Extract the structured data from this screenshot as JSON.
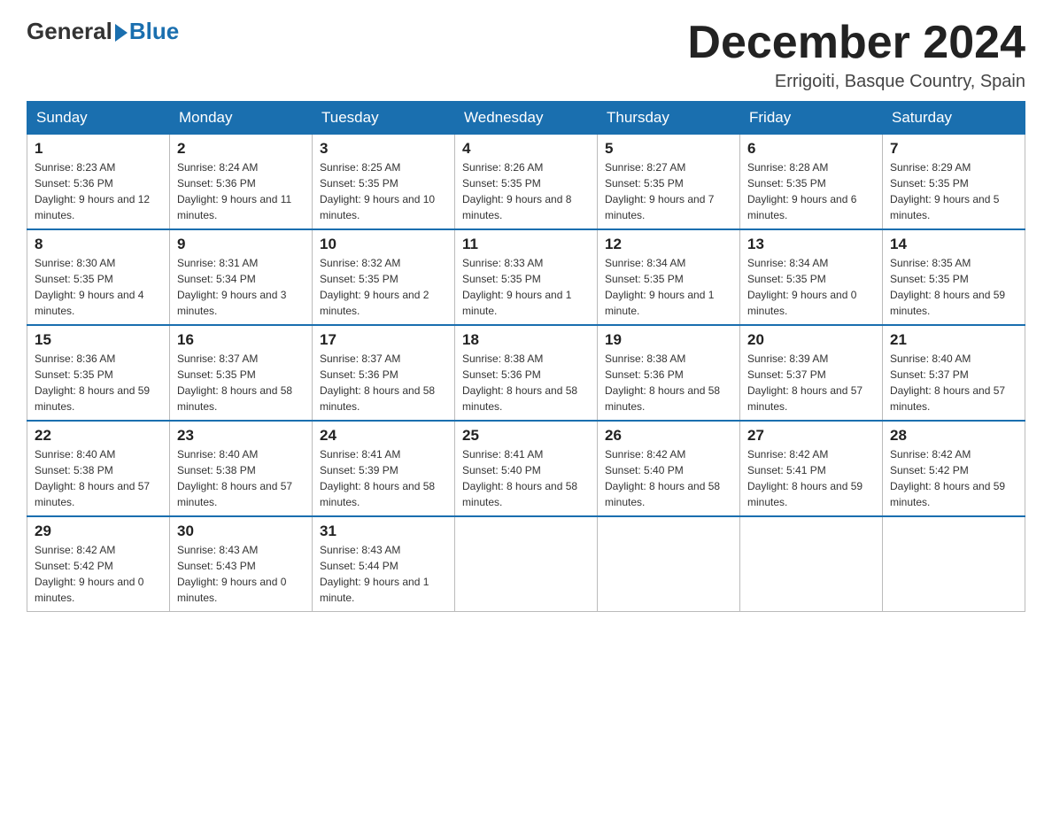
{
  "logo": {
    "text_general": "General",
    "text_blue": "Blue"
  },
  "header": {
    "month_year": "December 2024",
    "location": "Errigoiti, Basque Country, Spain"
  },
  "weekdays": [
    "Sunday",
    "Monday",
    "Tuesday",
    "Wednesday",
    "Thursday",
    "Friday",
    "Saturday"
  ],
  "weeks": [
    [
      {
        "day": "1",
        "sunrise": "8:23 AM",
        "sunset": "5:36 PM",
        "daylight": "9 hours and 12 minutes."
      },
      {
        "day": "2",
        "sunrise": "8:24 AM",
        "sunset": "5:36 PM",
        "daylight": "9 hours and 11 minutes."
      },
      {
        "day": "3",
        "sunrise": "8:25 AM",
        "sunset": "5:35 PM",
        "daylight": "9 hours and 10 minutes."
      },
      {
        "day": "4",
        "sunrise": "8:26 AM",
        "sunset": "5:35 PM",
        "daylight": "9 hours and 8 minutes."
      },
      {
        "day": "5",
        "sunrise": "8:27 AM",
        "sunset": "5:35 PM",
        "daylight": "9 hours and 7 minutes."
      },
      {
        "day": "6",
        "sunrise": "8:28 AM",
        "sunset": "5:35 PM",
        "daylight": "9 hours and 6 minutes."
      },
      {
        "day": "7",
        "sunrise": "8:29 AM",
        "sunset": "5:35 PM",
        "daylight": "9 hours and 5 minutes."
      }
    ],
    [
      {
        "day": "8",
        "sunrise": "8:30 AM",
        "sunset": "5:35 PM",
        "daylight": "9 hours and 4 minutes."
      },
      {
        "day": "9",
        "sunrise": "8:31 AM",
        "sunset": "5:34 PM",
        "daylight": "9 hours and 3 minutes."
      },
      {
        "day": "10",
        "sunrise": "8:32 AM",
        "sunset": "5:35 PM",
        "daylight": "9 hours and 2 minutes."
      },
      {
        "day": "11",
        "sunrise": "8:33 AM",
        "sunset": "5:35 PM",
        "daylight": "9 hours and 1 minute."
      },
      {
        "day": "12",
        "sunrise": "8:34 AM",
        "sunset": "5:35 PM",
        "daylight": "9 hours and 1 minute."
      },
      {
        "day": "13",
        "sunrise": "8:34 AM",
        "sunset": "5:35 PM",
        "daylight": "9 hours and 0 minutes."
      },
      {
        "day": "14",
        "sunrise": "8:35 AM",
        "sunset": "5:35 PM",
        "daylight": "8 hours and 59 minutes."
      }
    ],
    [
      {
        "day": "15",
        "sunrise": "8:36 AM",
        "sunset": "5:35 PM",
        "daylight": "8 hours and 59 minutes."
      },
      {
        "day": "16",
        "sunrise": "8:37 AM",
        "sunset": "5:35 PM",
        "daylight": "8 hours and 58 minutes."
      },
      {
        "day": "17",
        "sunrise": "8:37 AM",
        "sunset": "5:36 PM",
        "daylight": "8 hours and 58 minutes."
      },
      {
        "day": "18",
        "sunrise": "8:38 AM",
        "sunset": "5:36 PM",
        "daylight": "8 hours and 58 minutes."
      },
      {
        "day": "19",
        "sunrise": "8:38 AM",
        "sunset": "5:36 PM",
        "daylight": "8 hours and 58 minutes."
      },
      {
        "day": "20",
        "sunrise": "8:39 AM",
        "sunset": "5:37 PM",
        "daylight": "8 hours and 57 minutes."
      },
      {
        "day": "21",
        "sunrise": "8:40 AM",
        "sunset": "5:37 PM",
        "daylight": "8 hours and 57 minutes."
      }
    ],
    [
      {
        "day": "22",
        "sunrise": "8:40 AM",
        "sunset": "5:38 PM",
        "daylight": "8 hours and 57 minutes."
      },
      {
        "day": "23",
        "sunrise": "8:40 AM",
        "sunset": "5:38 PM",
        "daylight": "8 hours and 57 minutes."
      },
      {
        "day": "24",
        "sunrise": "8:41 AM",
        "sunset": "5:39 PM",
        "daylight": "8 hours and 58 minutes."
      },
      {
        "day": "25",
        "sunrise": "8:41 AM",
        "sunset": "5:40 PM",
        "daylight": "8 hours and 58 minutes."
      },
      {
        "day": "26",
        "sunrise": "8:42 AM",
        "sunset": "5:40 PM",
        "daylight": "8 hours and 58 minutes."
      },
      {
        "day": "27",
        "sunrise": "8:42 AM",
        "sunset": "5:41 PM",
        "daylight": "8 hours and 59 minutes."
      },
      {
        "day": "28",
        "sunrise": "8:42 AM",
        "sunset": "5:42 PM",
        "daylight": "8 hours and 59 minutes."
      }
    ],
    [
      {
        "day": "29",
        "sunrise": "8:42 AM",
        "sunset": "5:42 PM",
        "daylight": "9 hours and 0 minutes."
      },
      {
        "day": "30",
        "sunrise": "8:43 AM",
        "sunset": "5:43 PM",
        "daylight": "9 hours and 0 minutes."
      },
      {
        "day": "31",
        "sunrise": "8:43 AM",
        "sunset": "5:44 PM",
        "daylight": "9 hours and 1 minute."
      },
      null,
      null,
      null,
      null
    ]
  ]
}
